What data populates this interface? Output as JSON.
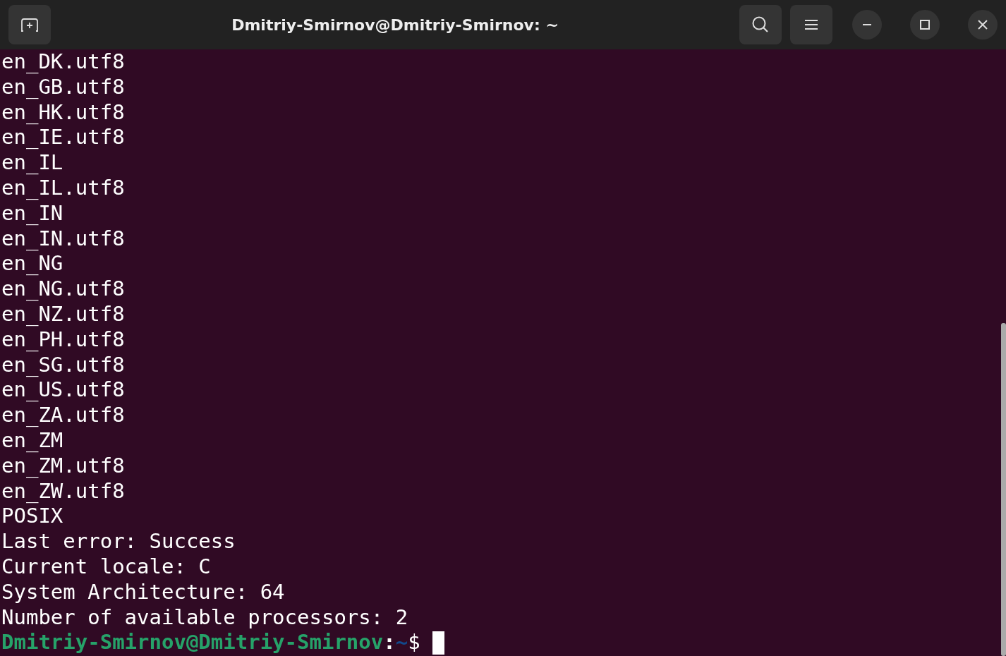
{
  "window": {
    "title": "Dmitriy-Smirnov@Dmitriy-Smirnov: ~"
  },
  "terminal": {
    "lines": [
      "en_DK.utf8",
      "en_GB.utf8",
      "en_HK.utf8",
      "en_IE.utf8",
      "en_IL",
      "en_IL.utf8",
      "en_IN",
      "en_IN.utf8",
      "en_NG",
      "en_NG.utf8",
      "en_NZ.utf8",
      "en_PH.utf8",
      "en_SG.utf8",
      "en_US.utf8",
      "en_ZA.utf8",
      "en_ZM",
      "en_ZM.utf8",
      "en_ZW.utf8",
      "POSIX",
      "Last error: Success",
      "Current locale: C",
      "System Architecture: 64",
      "Number of available processors: 2"
    ],
    "prompt": {
      "user_host": "Dmitriy-Smirnov@Dmitriy-Smirnov",
      "separator": ":",
      "path": "~",
      "symbol": "$"
    }
  }
}
